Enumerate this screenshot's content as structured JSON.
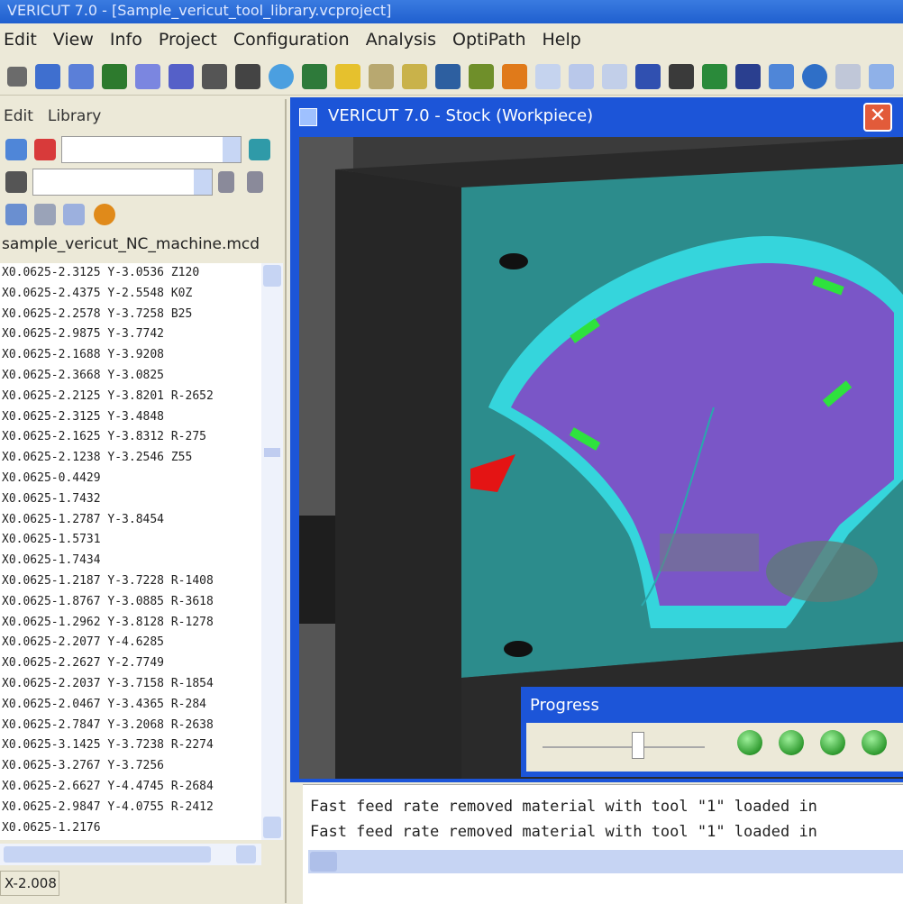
{
  "window": {
    "title": "VERICUT 7.0 - [Sample_vericut_tool_library.vcproject]"
  },
  "menu": [
    "Edit",
    "View",
    "Info",
    "Project",
    "Configuration",
    "Analysis",
    "OptiPath",
    "Help"
  ],
  "left_panel": {
    "tabs": [
      "Edit",
      "Library"
    ],
    "filename": "sample_vericut_NC_machine.mcd",
    "nc_lines": [
      "X0.0625-2.3125 Y-3.0536 Z120",
      "X0.0625-2.4375 Y-2.5548 K0Z",
      "X0.0625-2.2578 Y-3.7258 B25",
      "X0.0625-2.9875 Y-3.7742",
      "X0.0625-2.1688 Y-3.9208",
      "X0.0625-2.3668 Y-3.0825",
      "X0.0625-2.2125 Y-3.8201 R-2652",
      "X0.0625-2.3125 Y-3.4848",
      "X0.0625-2.1625 Y-3.8312 R-275",
      "X0.0625-2.1238 Y-3.2546 Z55",
      "X0.0625-0.4429",
      "X0.0625-1.7432",
      "X0.0625-1.2787 Y-3.8454",
      "X0.0625-1.5731",
      "X0.0625-1.7434",
      "X0.0625-1.2187 Y-3.7228 R-1408",
      "X0.0625-1.8767 Y-3.0885 R-3618",
      "X0.0625-1.2962 Y-3.8128 R-1278",
      "X0.0625-2.2077 Y-4.6285",
      "X0.0625-2.2627 Y-2.7749",
      "X0.0625-2.2037 Y-3.7158 R-1854",
      "X0.0625-2.0467 Y-3.4365 R-284",
      "X0.0625-2.7847 Y-3.2068 R-2638",
      "X0.0625-3.1425 Y-3.7238 R-2274",
      "X0.0625-3.2767 Y-3.7256",
      "X0.0625-2.6627 Y-4.4745 R-2684",
      "X0.0625-2.9847 Y-4.0755 R-2412",
      "X0.0625-1.2176"
    ],
    "status": "X-2.008"
  },
  "sim_window": {
    "title": "VERICUT 7.0 - Stock (Workpiece)",
    "close_glyph": "✕"
  },
  "progress": {
    "title": "Progress",
    "position_fraction": 0.55
  },
  "output_lines": [
    "Fast feed rate removed material with tool \"1\" loaded in",
    "Fast feed rate removed material with tool \"1\" loaded in"
  ],
  "colors": {
    "titlebar": "#2361d6",
    "fixture": "#2e8f8f",
    "pocket": "#7a56c7",
    "wall": "#35d5dc",
    "marker": "#2ee23d",
    "cutter": "#e41414"
  }
}
